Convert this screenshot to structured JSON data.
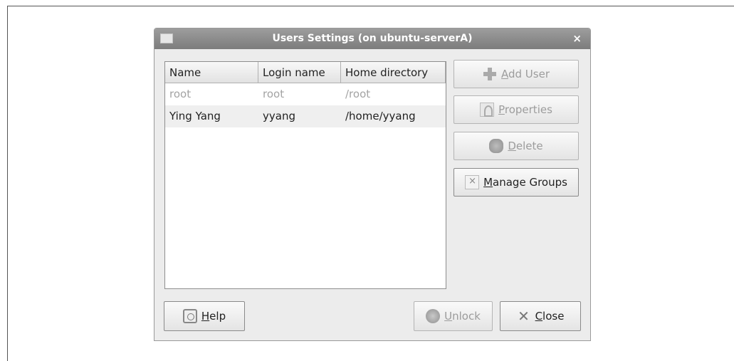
{
  "window": {
    "title": "Users Settings (on ubuntu-serverA)",
    "close_glyph": "×"
  },
  "table": {
    "columns": [
      "Name",
      "Login name",
      "Home directory"
    ],
    "rows": [
      {
        "name": "root",
        "login": "root",
        "home": "/root",
        "state": "disabled"
      },
      {
        "name": "Ying Yang",
        "login": "yyang",
        "home": "/home/yyang",
        "state": "normal"
      }
    ]
  },
  "buttons": {
    "add_user": {
      "mnemonic": "A",
      "rest": "dd User",
      "icon": "plus-icon",
      "enabled": false
    },
    "properties": {
      "mnemonic": "P",
      "rest": "roperties",
      "icon": "properties-icon",
      "enabled": false
    },
    "delete": {
      "mnemonic": "D",
      "rest": "elete",
      "icon": "delete-icon",
      "enabled": false
    },
    "manage_groups": {
      "mnemonic": "M",
      "rest": "anage Groups",
      "icon": "groups-icon",
      "enabled": true
    },
    "help": {
      "mnemonic": "H",
      "rest": "elp",
      "icon": "help-icon",
      "enabled": true
    },
    "unlock": {
      "mnemonic": "U",
      "rest": "nlock",
      "icon": "unlock-icon",
      "enabled": false
    },
    "close": {
      "mnemonic": "C",
      "rest": "lose",
      "icon": "close-icon",
      "enabled": true
    }
  }
}
